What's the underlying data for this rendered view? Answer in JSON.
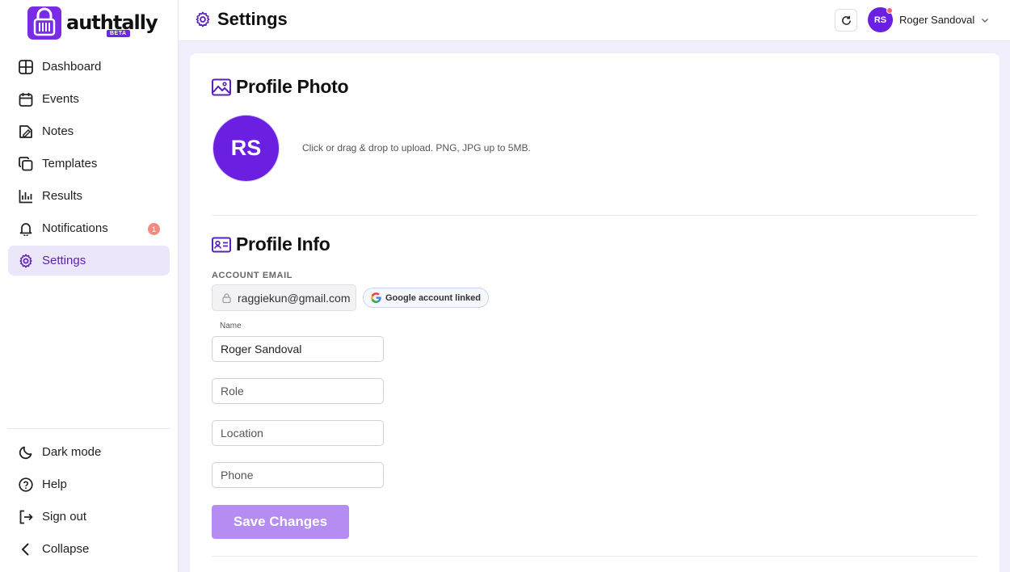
{
  "app": {
    "name": "authtally",
    "badge": "BETA"
  },
  "sidebar": {
    "items": [
      {
        "label": "Dashboard"
      },
      {
        "label": "Events"
      },
      {
        "label": "Notes"
      },
      {
        "label": "Templates"
      },
      {
        "label": "Results"
      },
      {
        "label": "Notifications",
        "badge": "1"
      },
      {
        "label": "Settings"
      }
    ],
    "bottom": [
      {
        "label": "Dark mode"
      },
      {
        "label": "Help"
      },
      {
        "label": "Sign out"
      },
      {
        "label": "Collapse"
      }
    ]
  },
  "header": {
    "title": "Settings",
    "user": {
      "initials": "RS",
      "name": "Roger Sandoval"
    }
  },
  "profile_photo": {
    "title": "Profile Photo",
    "initials": "RS",
    "hint": "Click or drag & drop to upload. PNG, JPG up to 5MB."
  },
  "profile_info": {
    "title": "Profile Info",
    "email_label": "ACCOUNT EMAIL",
    "email": "raggiekun@gmail.com",
    "google_chip": "Google account linked",
    "name_label": "Name",
    "name_value": "Roger Sandoval",
    "role_placeholder": "Role",
    "location_placeholder": "Location",
    "phone_placeholder": "Phone",
    "save_label": "Save Changes"
  },
  "colors": {
    "accent": "#6b1fe0",
    "active_bg": "#ece6fb",
    "save_disabled": "#b48cf2"
  }
}
